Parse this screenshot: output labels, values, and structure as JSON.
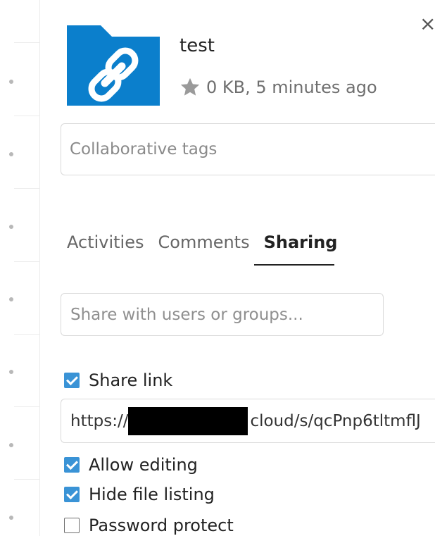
{
  "left_list": {
    "rows": 7
  },
  "file": {
    "name": "test",
    "meta": "0 KB, 5 minutes ago",
    "folder_color": "#0b7fcc"
  },
  "close_label": "×",
  "tags": {
    "placeholder": "Collaborative tags"
  },
  "tabs": [
    {
      "label": "Activities",
      "active": false
    },
    {
      "label": "Comments",
      "active": false
    },
    {
      "label": "Sharing",
      "active": true
    }
  ],
  "share_with": {
    "placeholder": "Share with users or groups..."
  },
  "share_link": {
    "label": "Share link",
    "checked": true
  },
  "link": {
    "prefix": "https://",
    "suffix": "cloud/s/qcPnp6tltmflJ"
  },
  "options": [
    {
      "label": "Allow editing",
      "checked": true
    },
    {
      "label": "Hide file listing",
      "checked": true
    },
    {
      "label": "Password protect",
      "checked": false
    }
  ],
  "colors": {
    "checkbox": "#3a93d6",
    "accent": "#0b7fcc"
  }
}
